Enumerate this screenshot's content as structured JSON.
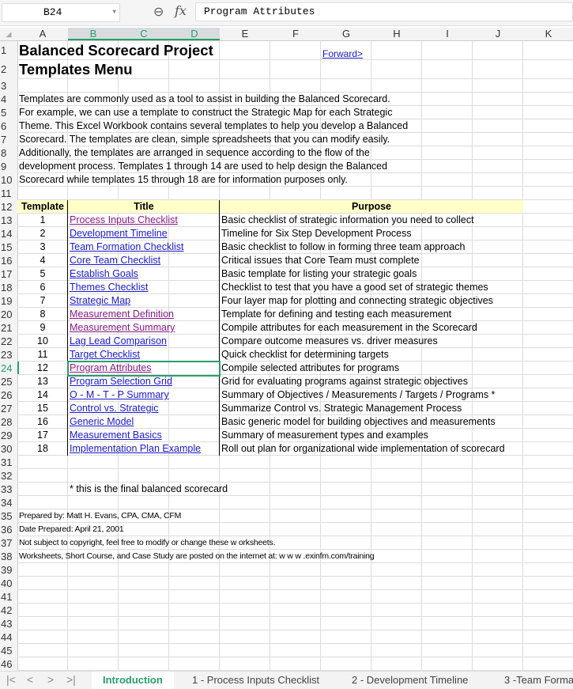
{
  "toolbar": {
    "name_box": "B24",
    "formula": "Program Attributes",
    "zoom_icon": "zoom-icon",
    "fx_label": "fx"
  },
  "columns": [
    "A",
    "B",
    "C",
    "D",
    "E",
    "F",
    "G",
    "H",
    "I",
    "J",
    "K"
  ],
  "selected_columns": [
    "B",
    "C",
    "D"
  ],
  "selected_row": 24,
  "row_count": 46,
  "header": {
    "title1": "Balanced Scorecard Project",
    "title2": "Templates Menu",
    "forward_link": "Forward>"
  },
  "intro_lines": [
    "Templates are commonly used as a tool to assist in building the Balanced Scorecard.",
    "For example, we can use a template to construct the Strategic Map for each Strategic",
    "Theme. This Excel Workbook contains several templates to help you develop a Balanced",
    "Scorecard. The templates are clean, simple spreadsheets that you can modify easily.",
    "Additionally, the templates are arranged in sequence according to the flow of the",
    "development process. Templates 1 through 14 are used to help design the Balanced",
    "Scorecard while templates 15 through 18 are for information purposes only."
  ],
  "table": {
    "headers": [
      "Template",
      "Title",
      "Purpose"
    ],
    "header_color": "#ffffc8",
    "rows": [
      {
        "n": "1",
        "title": "Process Inputs Checklist",
        "visited": true,
        "purpose": "Basic checklist of strategic information you need to collect"
      },
      {
        "n": "2",
        "title": "Development Timeline",
        "visited": false,
        "purpose": "Timeline for Six Step Development Process"
      },
      {
        "n": "3",
        "title": "Team Formation Checklist",
        "visited": false,
        "purpose": "Basic checklist to follow in forming three team approach"
      },
      {
        "n": "4",
        "title": "Core Team Checklist",
        "visited": false,
        "purpose": "Critical issues that Core Team must complete"
      },
      {
        "n": "5",
        "title": "Establish Goals",
        "visited": false,
        "purpose": "Basic template for listing your strategic goals"
      },
      {
        "n": "6",
        "title": "Themes Checklist",
        "visited": false,
        "purpose": "Checklist to test that you have a good set of strategic themes"
      },
      {
        "n": "7",
        "title": "Strategic Map",
        "visited": false,
        "purpose": "Four layer map for plotting and connecting strategic objectives"
      },
      {
        "n": "8",
        "title": "Measurement Definition",
        "visited": true,
        "purpose": "Template for defining and testing each measurement"
      },
      {
        "n": "9",
        "title": "Measurement Summary",
        "visited": true,
        "purpose": "Compile attributes for each measurement in the Scorecard"
      },
      {
        "n": "10",
        "title": "Lag Lead Comparison",
        "visited": false,
        "purpose": "Compare outcome measures vs. driver measures"
      },
      {
        "n": "11",
        "title": "Target Checklist",
        "visited": false,
        "purpose": "Quick checklist for determining targets"
      },
      {
        "n": "12",
        "title": "Program Attributes",
        "visited": true,
        "purpose": "Compile selected attributes for programs"
      },
      {
        "n": "13",
        "title": "Program Selection Grid",
        "visited": false,
        "purpose": "Grid for evaluating programs against strategic objectives"
      },
      {
        "n": "14",
        "title": "O - M - T - P Summary",
        "visited": false,
        "purpose": "Summary of Objectives / Measurements / Targets / Programs *"
      },
      {
        "n": "15",
        "title": "Control vs. Strategic",
        "visited": false,
        "purpose": "Summarize Control vs. Strategic Management Process"
      },
      {
        "n": "16",
        "title": "Generic Model",
        "visited": false,
        "purpose": "Basic generic model for building objectives and measurements"
      },
      {
        "n": "17",
        "title": "Measurement Basics",
        "visited": false,
        "purpose": "Summary of measurement types and examples"
      },
      {
        "n": "18",
        "title": "Implementation Plan Example",
        "visited": false,
        "purpose": "Roll out plan for organizational wide implementation of scorecard"
      }
    ]
  },
  "footnote": "* this is the final balanced scorecard",
  "footer_lines": [
    "Prepared by: Matt H. Evans, CPA, CMA, CFM",
    "Date Prepared: April 21, 2001",
    "Not subject to copyright, feel free to modify or change these w orksheets.",
    "Worksheets, Short Course, and Case Study are posted on the internet at: w w w .exinfm.com/training"
  ],
  "sheet_tabs": [
    "Introduction",
    "1 - Process Inputs Checklist",
    "2 - Development Timeline",
    "3 -Team Forma"
  ],
  "active_tab": "Introduction",
  "colors": {
    "accent": "#2a9d6a",
    "link": "#1a1ad0",
    "visited_link": "#8a1a8a"
  }
}
